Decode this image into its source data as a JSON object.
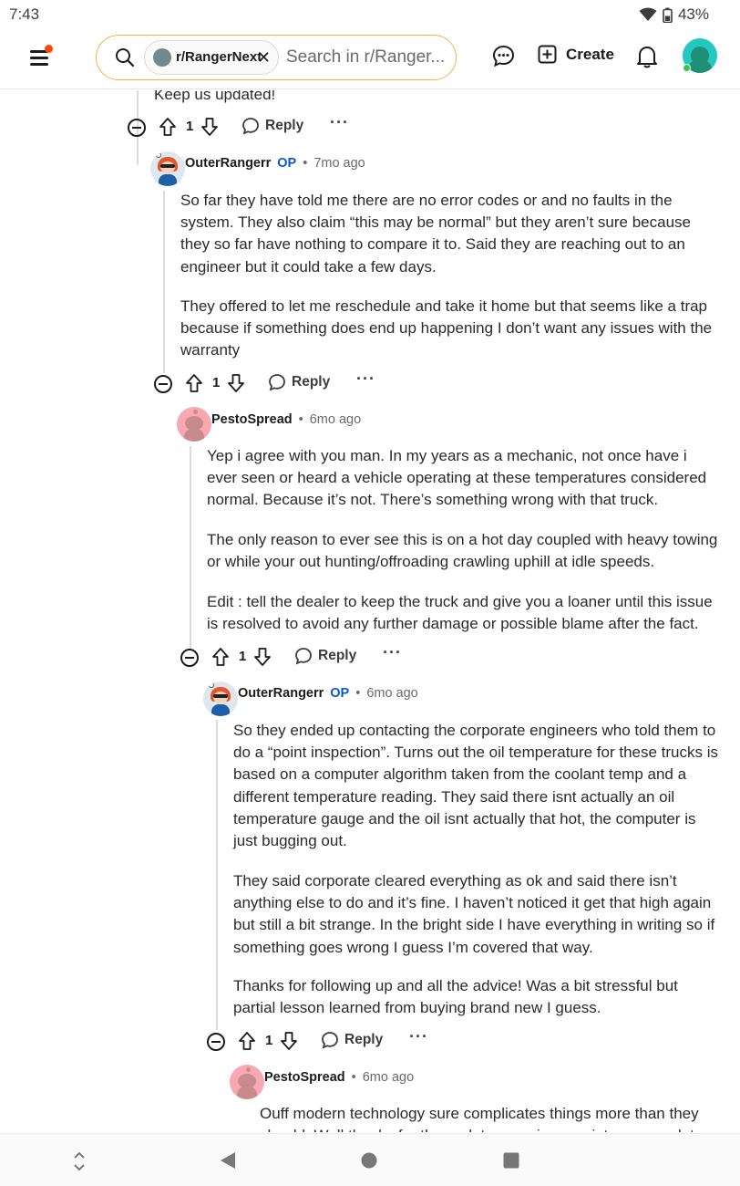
{
  "status_bar": {
    "time": "7:43",
    "battery": "43%"
  },
  "header": {
    "community_chip": "r/RangerNext",
    "search_placeholder": "Search in r/Ranger...",
    "create_label": "Create"
  },
  "thread": {
    "top_snippet": "Keep us updated!",
    "comments": [
      {
        "vote_count": "1",
        "reply_label": "Reply",
        "more": "···"
      },
      {
        "author": "OuterRangerr",
        "op_badge": "OP",
        "sep": "•",
        "time": "7mo ago",
        "paragraphs": [
          "So far they have told me there are no error codes or and no faults in the system. They also claim “this may be normal” but they aren’t sure because they so far have nothing to compare it to. Said they are reaching out to an engineer but it could take a few days.",
          "They offered to let me reschedule and take it home but that seems like a trap because if something does end up happening I don’t want any issues with the warranty"
        ],
        "vote_count": "1",
        "reply_label": "Reply",
        "more": "···"
      },
      {
        "author": "PestoSpread",
        "sep": "•",
        "time": "6mo ago",
        "paragraphs": [
          "Yep i agree with you man. In my years as a mechanic, not once have i ever seen or heard a vehicle operating at these temperatures considered normal. Because it’s not. There’s something wrong with that truck.",
          "The only reason to ever see this is on a hot day coupled with heavy towing or while your out hunting/offroading crawling uphill at idle speeds.",
          "Edit : tell the dealer to keep the truck and give you a loaner until this issue is resolved to avoid any further damage or possible blame after the fact."
        ],
        "vote_count": "1",
        "reply_label": "Reply",
        "more": "···"
      },
      {
        "author": "OuterRangerr",
        "op_badge": "OP",
        "sep": "•",
        "time": "6mo ago",
        "paragraphs": [
          "So they ended up contacting the corporate engineers who told them to do a “point inspection”. Turns out the oil temperature for these trucks is based on a computer algorithm taken from the coolant temp and a different temperature reading. They said there isnt actually an oil temperature gauge and the oil isnt actually that hot, the computer is just bugging out.",
          "They said corporate cleared everything as ok and said there isn’t anything else to do and it’s fine. I haven’t noticed it get that high again but still a bit strange. In the bright side I have everything in writing so if something goes wrong I guess I’m covered that way.",
          "Thanks for following up and all the advice! Was a bit stressful but partial lesson learned from buying brand new I guess."
        ],
        "vote_count": "1",
        "reply_label": "Reply",
        "more": "···"
      },
      {
        "author": "PestoSpread",
        "sep": "•",
        "time": "6mo ago",
        "paragraphs": [
          "Ouff modern technology sure complicates things more than they should. Well thanks for the update man, i appreciate your updat"
        ]
      }
    ]
  }
}
